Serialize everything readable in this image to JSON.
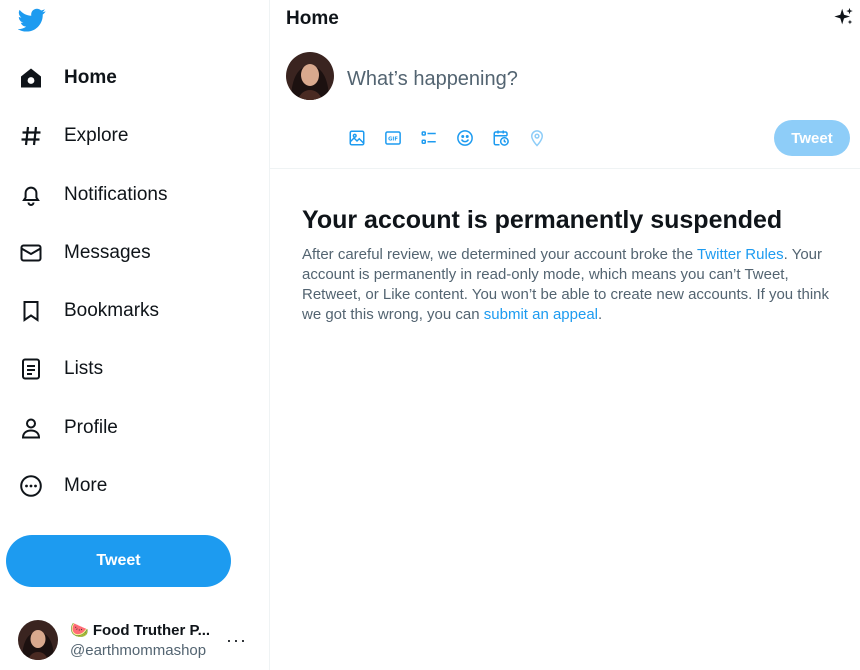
{
  "colors": {
    "brand": "#1d9bf0",
    "brand_disabled": "#8ecdf8",
    "text_primary": "#0f1419",
    "text_secondary": "#536471",
    "divider": "#eff3f4"
  },
  "sidebar": {
    "logo_icon": "bird-logo-icon",
    "items": [
      {
        "label": "Home",
        "icon": "home-icon",
        "active": true
      },
      {
        "label": "Explore",
        "icon": "hashtag-icon"
      },
      {
        "label": "Notifications",
        "icon": "bell-icon"
      },
      {
        "label": "Messages",
        "icon": "envelope-icon"
      },
      {
        "label": "Bookmarks",
        "icon": "bookmark-icon"
      },
      {
        "label": "Lists",
        "icon": "list-icon"
      },
      {
        "label": "Profile",
        "icon": "person-icon"
      },
      {
        "label": "More",
        "icon": "more-circle-icon"
      }
    ],
    "tweet_button": "Tweet",
    "account": {
      "emoji": "🍉",
      "name": "Food Truther P...",
      "handle": "@earthmommashop",
      "more": "···"
    }
  },
  "main": {
    "title": "Home",
    "compose": {
      "placeholder": "What’s happening?",
      "tweet_button": "Tweet",
      "tools": [
        "media-icon",
        "gif-icon",
        "poll-icon",
        "emoji-icon",
        "schedule-icon",
        "location-icon"
      ]
    },
    "suspension": {
      "title": "Your account is permanently suspended",
      "body_1": "After careful review, we determined your account broke the ",
      "link_1": "Twitter Rules",
      "body_2": ". Your account is permanently in read-only mode, which means you can’t Tweet, Retweet, or Like content. You won’t be able to create new accounts. If you think we got this wrong, you can ",
      "link_2": "submit an appeal",
      "body_3": "."
    }
  }
}
